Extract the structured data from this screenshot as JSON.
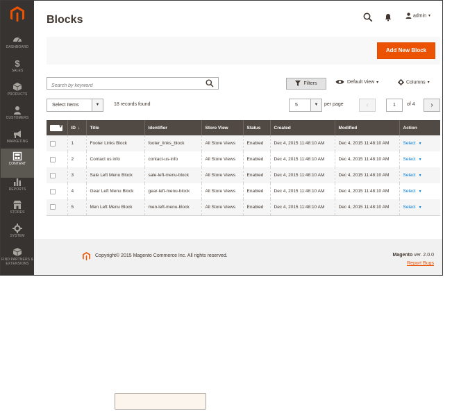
{
  "sidebar": {
    "items": [
      {
        "label": "Dashboard",
        "icon": "dashboard-icon"
      },
      {
        "label": "Sales",
        "icon": "dollar-icon"
      },
      {
        "label": "Products",
        "icon": "box-icon"
      },
      {
        "label": "Customers",
        "icon": "person-icon"
      },
      {
        "label": "Marketing",
        "icon": "megaphone-icon"
      },
      {
        "label": "Content",
        "icon": "content-icon",
        "active": true
      },
      {
        "label": "Reports",
        "icon": "bar-chart-icon"
      },
      {
        "label": "Stores",
        "icon": "store-icon"
      },
      {
        "label": "System",
        "icon": "gear-icon"
      },
      {
        "label": "Find Partners & Extensions",
        "icon": "partners-icon"
      }
    ]
  },
  "header": {
    "title": "Blocks",
    "user": "admin"
  },
  "toolbar": {
    "add_label": "Add New Block",
    "search_placeholder": "Search by keyword",
    "filters_label": "Filters",
    "view_label": "Default View",
    "columns_label": "Columns",
    "select_items_label": "Select Items",
    "records_found": "18 records found",
    "per_page_value": "5",
    "per_page_label": "per page",
    "current_page": "1",
    "of_pages": "of 4"
  },
  "table": {
    "columns": [
      "ID",
      "Title",
      "Identifier",
      "Store View",
      "Status",
      "Created",
      "Modified",
      "Action"
    ],
    "rows": [
      {
        "id": "1",
        "title": "Footer Links Block",
        "identifier": "footer_links_block",
        "store_view": "All Store Views",
        "status": "Enabled",
        "created": "Dec 4, 2015 11:48:10 AM",
        "modified": "Dec 4, 2015 11:48:10 AM",
        "action": "Select"
      },
      {
        "id": "2",
        "title": "Contact us info",
        "identifier": "contact-us-info",
        "store_view": "All Store Views",
        "status": "Enabled",
        "created": "Dec 4, 2015 11:48:10 AM",
        "modified": "Dec 4, 2015 11:48:10 AM",
        "action": "Select"
      },
      {
        "id": "3",
        "title": "Sale Left Menu Block",
        "identifier": "sale-left-menu-block",
        "store_view": "All Store Views",
        "status": "Enabled",
        "created": "Dec 4, 2015 11:48:10 AM",
        "modified": "Dec 4, 2015 11:48:10 AM",
        "action": "Select"
      },
      {
        "id": "4",
        "title": "Gear Left Menu Block",
        "identifier": "gear-left-menu-block",
        "store_view": "All Store Views",
        "status": "Enabled",
        "created": "Dec 4, 2015 11:48:10 AM",
        "modified": "Dec 4, 2015 11:48:10 AM",
        "action": "Select"
      },
      {
        "id": "5",
        "title": "Men Left Menu Block",
        "identifier": "men-left-menu-block",
        "store_view": "All Store Views",
        "status": "Enabled",
        "created": "Dec 4, 2015 11:48:10 AM",
        "modified": "Dec 4, 2015 11:48:10 AM",
        "action": "Select"
      }
    ]
  },
  "footer": {
    "copyright": "Copyright© 2015 Magento Commerce Inc. All rights reserved.",
    "brand": "Magento",
    "version": "ver. 2.0.0",
    "report_bugs": "Report Bugs"
  },
  "colors": {
    "accent": "#eb5202",
    "sidebar": "#373330",
    "table_header": "#514943",
    "link": "#007bdb"
  }
}
